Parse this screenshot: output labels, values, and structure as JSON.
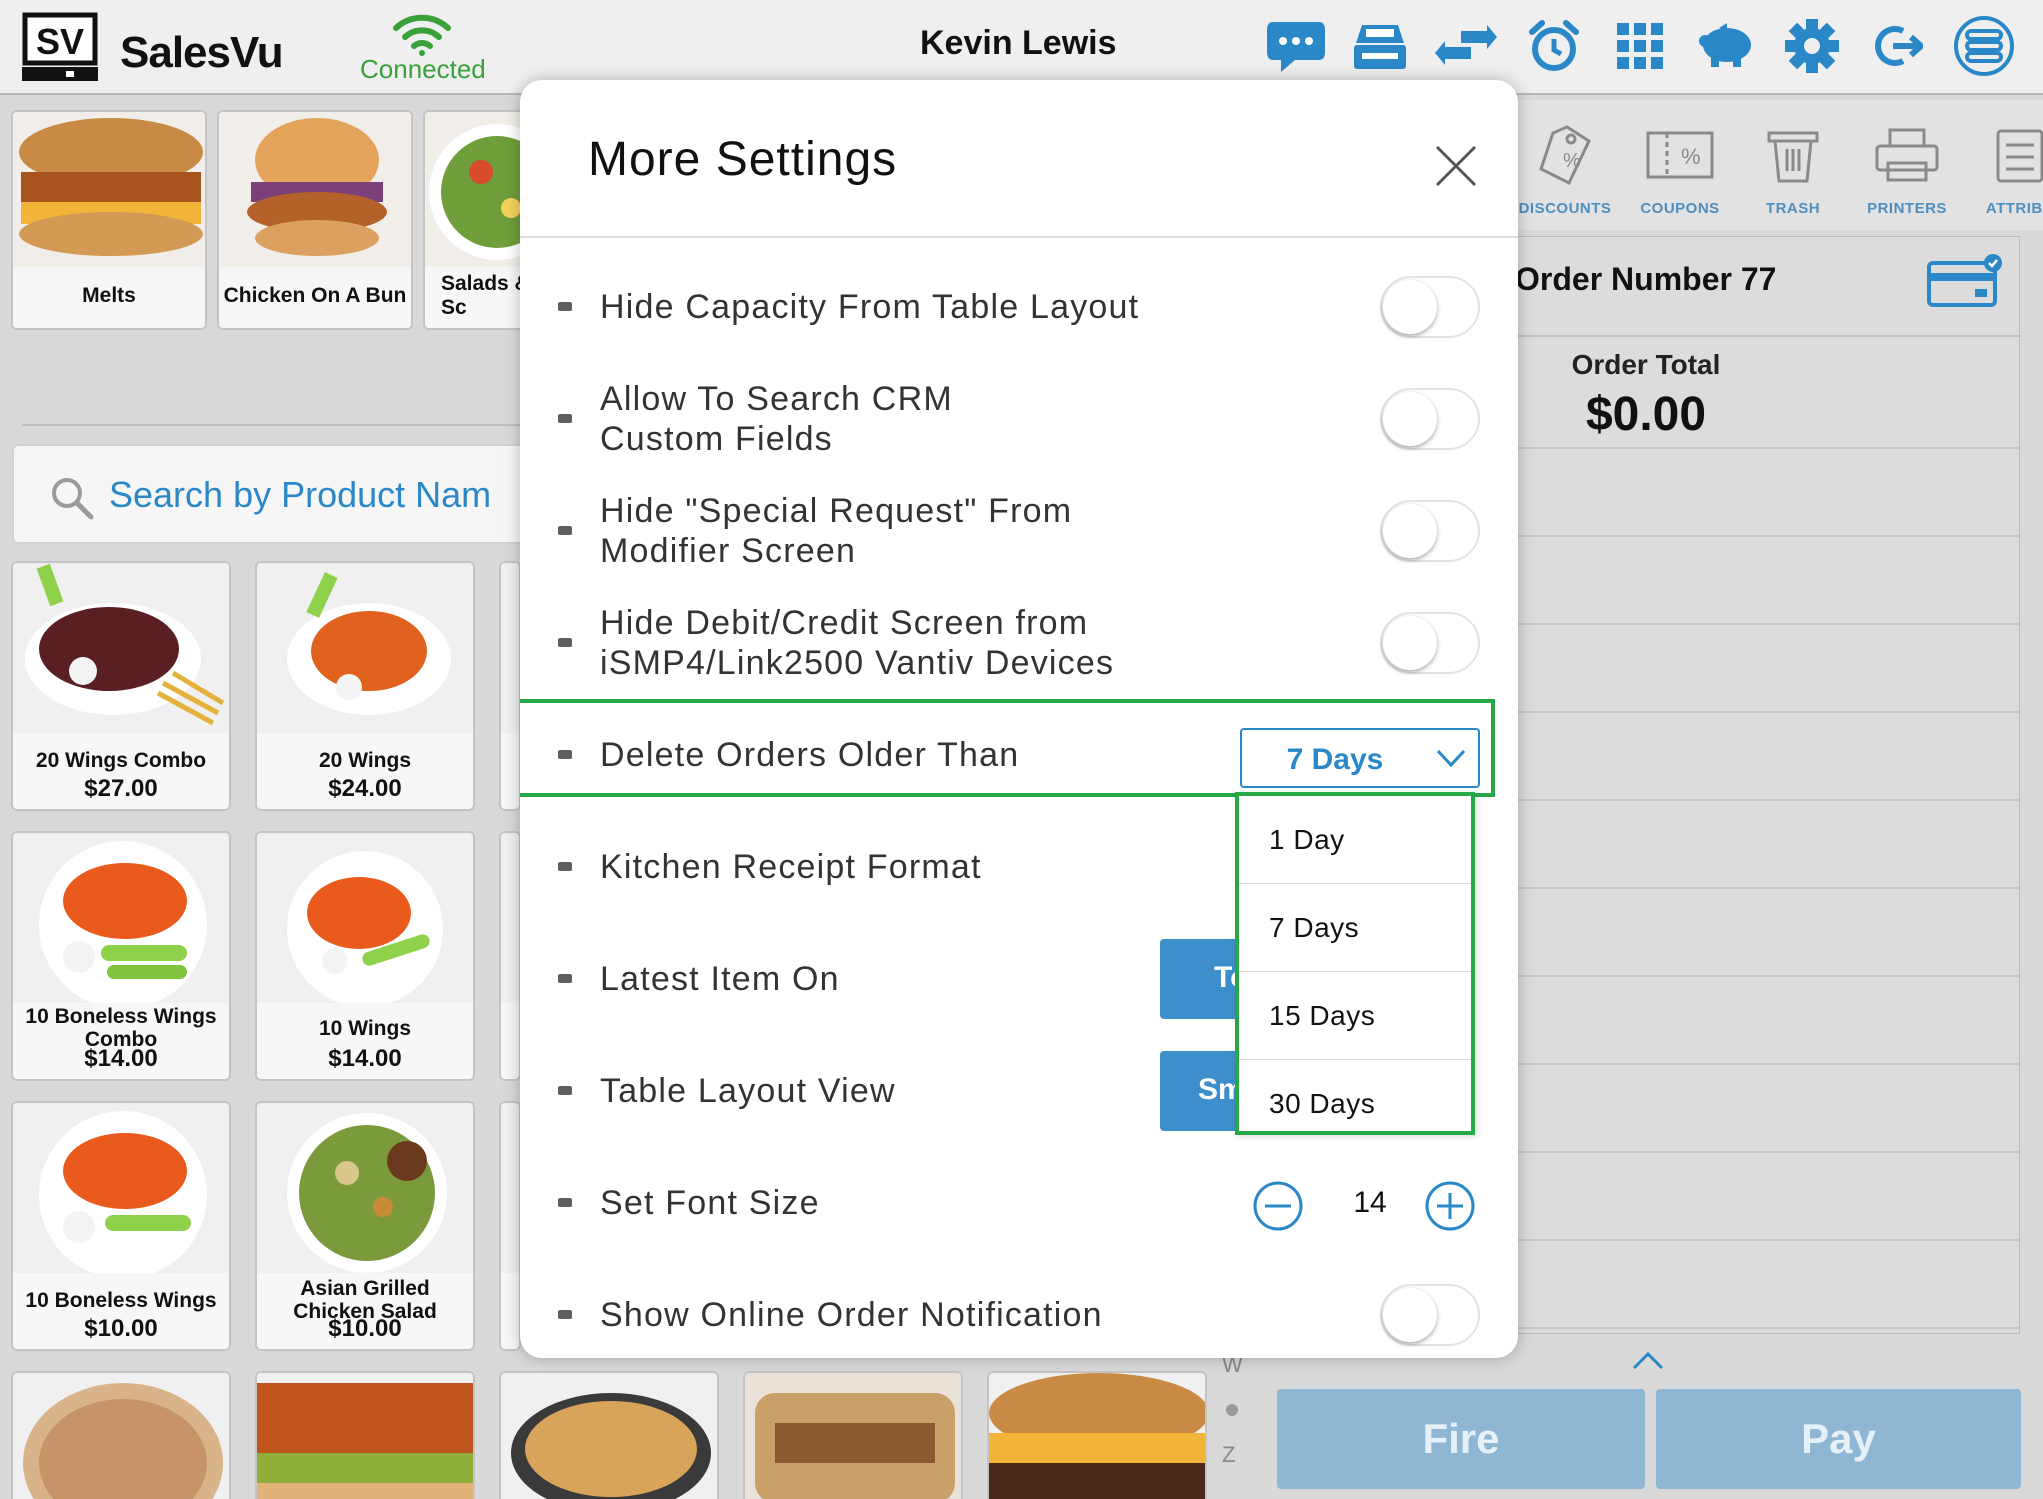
{
  "header": {
    "logo_text": "SV",
    "brand": "SalesVu",
    "connection_status": "Connected",
    "user_name": "Kevin Lewis",
    "icons": [
      "chat-icon",
      "register-icon",
      "transfer-icon",
      "alarm-icon",
      "grid-icon",
      "piggy-bank-icon",
      "gear-icon",
      "logout-icon",
      "menu-list-icon"
    ]
  },
  "categories": [
    {
      "label": "Melts"
    },
    {
      "label": "Chicken On A Bun"
    },
    {
      "label": "Salads & Sc"
    }
  ],
  "search": {
    "placeholder": "Search by Product Nam"
  },
  "products": [
    {
      "name": "20 Wings Combo",
      "price": "$27.00"
    },
    {
      "name": "20 Wings",
      "price": "$24.00"
    },
    {
      "name": "10 Boneless Wings Combo",
      "price": "$14.00"
    },
    {
      "name": "10 Wings",
      "price": "$14.00"
    },
    {
      "name": "10 Boneless Wings",
      "price": "$10.00"
    },
    {
      "name": "Asian Grilled Chicken Salad",
      "price": "$10.00"
    }
  ],
  "toolbar": {
    "discounts": "DISCOUNTS",
    "coupons": "COUPONS",
    "trash": "TRASH",
    "printers": "PRINTERS",
    "attributes": "ATTRIBU"
  },
  "order": {
    "number": "Order Number 77",
    "total_label": "Order Total",
    "total": "$0.00",
    "fire": "Fire",
    "pay": "Pay"
  },
  "alpha_index": {
    "top": "W",
    "bottom": "Z"
  },
  "modal": {
    "title": "More Settings",
    "settings": {
      "hide_capacity": "Hide Capacity From Table Layout",
      "search_crm": "Allow To Search CRM\nCustom Fields",
      "hide_special": "Hide \"Special Request\" From\nModifier Screen",
      "hide_debit": "Hide Debit/Credit Screen from\niSMP4/Link2500 Vantiv Devices",
      "delete_orders": "Delete Orders Older Than",
      "kitchen_format": "Kitchen Receipt Format",
      "latest_item": "Latest Item On",
      "table_layout": "Table Layout View",
      "font_size": "Set Font Size",
      "online_notification": "Show Online Order Notification"
    },
    "toggles": {
      "hide_capacity": false,
      "search_crm": false,
      "hide_special": false,
      "hide_debit": false,
      "online_notification": false
    },
    "delete_orders_value": "7 Days",
    "latest_item_button": "To",
    "table_layout_button": "Sm",
    "font_size_value": "14",
    "dropdown_options": [
      "1 Day",
      "7 Days",
      "15 Days",
      "30 Days"
    ]
  },
  "colors": {
    "accent": "#2a88c9",
    "highlight": "#27a846",
    "connected": "#3aa03a",
    "action_button": "#8fb7d3"
  }
}
